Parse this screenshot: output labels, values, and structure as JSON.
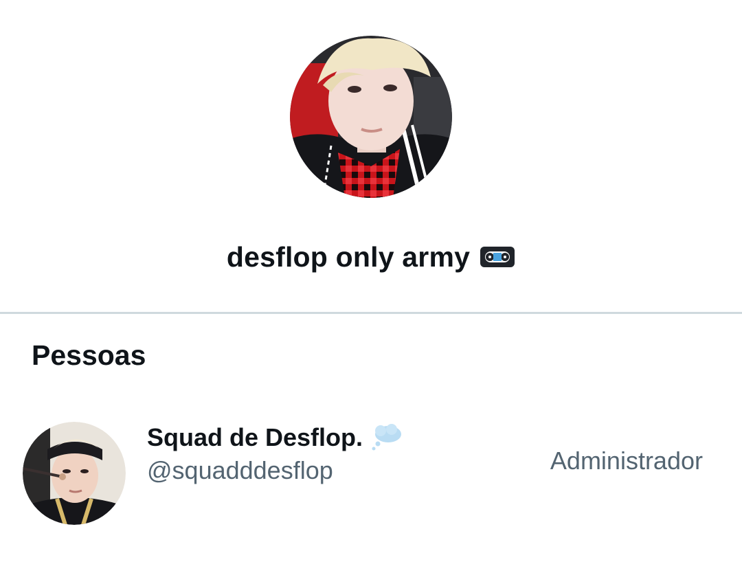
{
  "group": {
    "avatar_icon": "group-photo",
    "title": "desflop only army",
    "title_emoji_icon": "vhs-tape-icon"
  },
  "members_section": {
    "title": "Pessoas",
    "members": [
      {
        "avatar_icon": "member-photo",
        "display_name": "Squad de Desflop.",
        "name_emoji_icon": "thought-balloon-icon",
        "handle": "@squadddesflop",
        "role": "Administrador"
      }
    ]
  },
  "colors": {
    "primary_text": "#0f1419",
    "secondary_text": "#536471",
    "divider": "#cfd9de",
    "background": "#ffffff"
  }
}
